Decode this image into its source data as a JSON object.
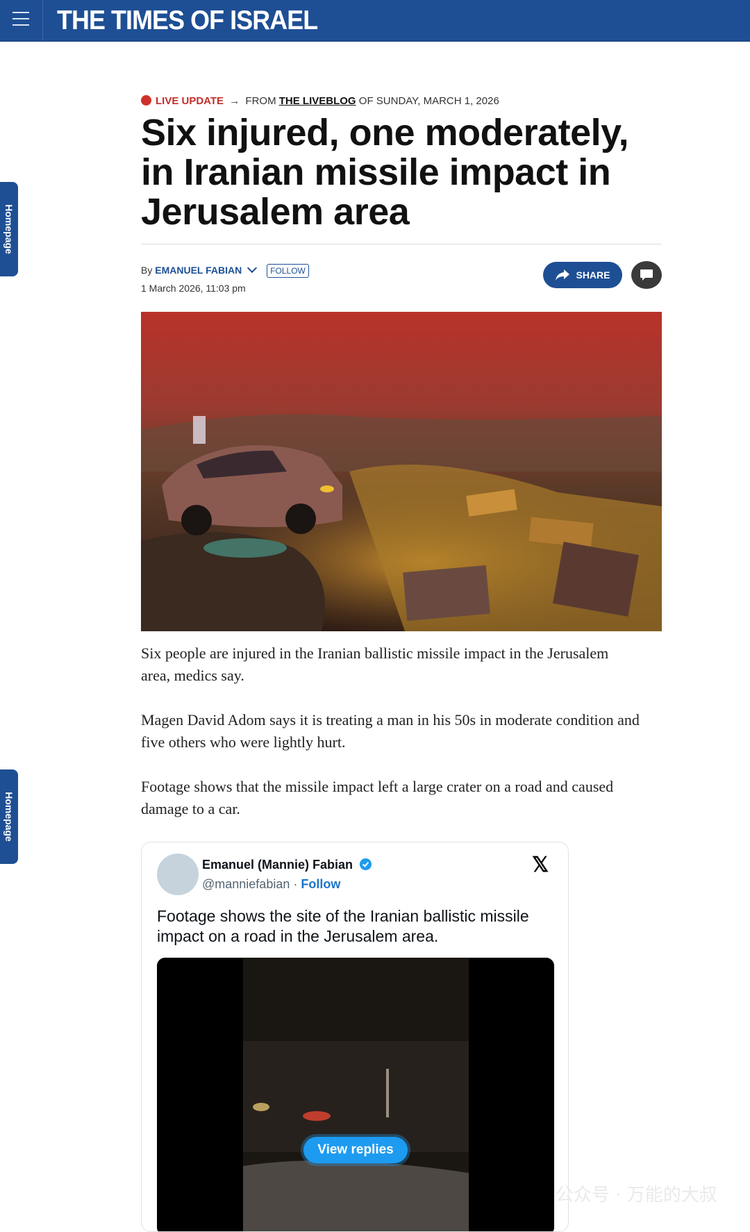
{
  "header": {
    "logo": "THE TIMES OF ISRAEL"
  },
  "side_tabs": {
    "upper": "Homepage",
    "lower": "Homepage"
  },
  "kicker": {
    "live": "LIVE UPDATE",
    "arrow": "→",
    "from": "FROM",
    "liveblog": "THE LIVEBLOG",
    "of_date": "OF SUNDAY, MARCH 1, 2026"
  },
  "headline": "Six injured, one moderately, in Iranian missile impact in Jerusalem area",
  "byline": {
    "by": "By",
    "author": "EMANUEL FABIAN",
    "follow": "FOLLOW",
    "date": "1 March 2026, 11:03 pm"
  },
  "actions": {
    "share": "SHARE"
  },
  "body": [
    "Six people are injured in the Iranian ballistic missile impact in the Jerusalem area, medics say.",
    "Magen David Adom says it is treating a man in his 50s in moderate condition and five others who were lightly hurt.",
    "Footage shows that the missile impact left a large crater on a road and caused damage to a car."
  ],
  "tweet": {
    "name": "Emanuel (Mannie) Fabian",
    "handle": "@manniefabian",
    "separator": "·",
    "follow": "Follow",
    "x_logo": "𝕏",
    "text": "Footage shows the site of the Iranian ballistic missile impact on a road in the Jerusalem area.",
    "view_replies": "View replies"
  },
  "watermark": "公众号 · 万能的大叔",
  "colors": {
    "brand": "#1e4f94",
    "live_red": "#c0302a",
    "twitter_blue": "#1d9bf0"
  }
}
